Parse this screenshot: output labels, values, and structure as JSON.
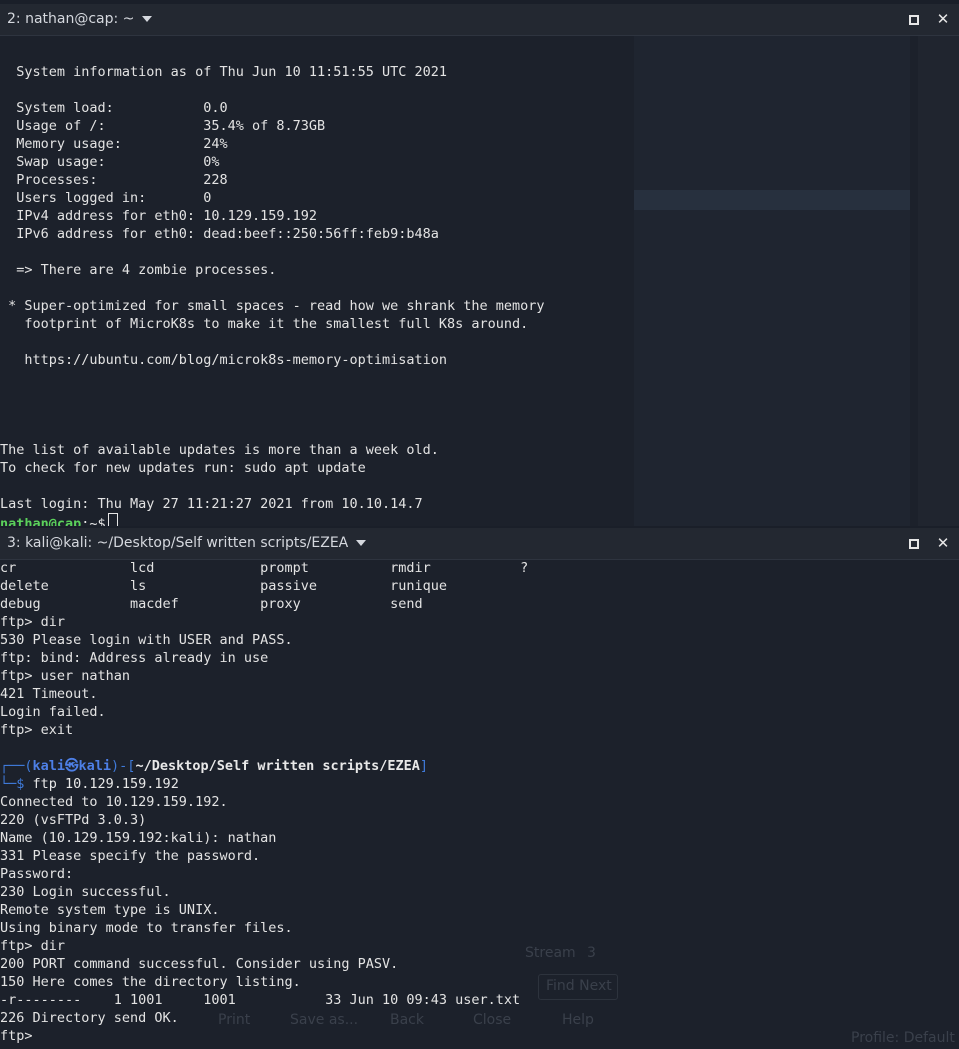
{
  "top_pane": {
    "title": "2: nathan@cap: ~",
    "lines": [
      "",
      "  System information as of Thu Jun 10 11:51:55 UTC 2021",
      "",
      "  System load:           0.0",
      "  Usage of /:            35.4% of 8.73GB",
      "  Memory usage:          24%",
      "  Swap usage:            0%",
      "  Processes:             228",
      "  Users logged in:       0",
      "  IPv4 address for eth0: 10.129.159.192",
      "  IPv6 address for eth0: dead:beef::250:56ff:feb9:b48a",
      "",
      "  => There are 4 zombie processes.",
      "",
      " * Super-optimized for small spaces - read how we shrank the memory",
      "   footprint of MicroK8s to make it the smallest full K8s around.",
      "",
      "   https://ubuntu.com/blog/microk8s-memory-optimisation",
      "",
      "",
      "",
      "",
      "The list of available updates is more than a week old.",
      "To check for new updates run: sudo apt update",
      "",
      "Last login: Thu May 27 11:21:27 2021 from 10.10.14.7"
    ],
    "prompt_user_host": "nathan@cap",
    "prompt_suffix": ":~$"
  },
  "bottom_pane": {
    "title": "3: kali@kali: ~/Desktop/Self written scripts/EZEA",
    "lines_before": [
      "cr              lcd             prompt          rmdir           ?",
      "delete          ls              passive         runique",
      "debug           macdef          proxy           send",
      "ftp> dir",
      "530 Please login with USER and PASS.",
      "ftp: bind: Address already in use",
      "ftp> user nathan",
      "421 Timeout.",
      "Login failed.",
      "ftp> exit",
      ""
    ],
    "prompt_head": "┌──(",
    "prompt_user": "kali㉿kali",
    "prompt_mid": ")-[",
    "prompt_path": "~/Desktop/Self written scripts/EZEA",
    "prompt_tail": "]",
    "prompt2_head": "└─$",
    "prompt2_cmd": " ftp 10.129.159.192",
    "lines_after": [
      "Connected to 10.129.159.192.",
      "220 (vsFTPd 3.0.3)",
      "Name (10.129.159.192:kali): nathan",
      "331 Please specify the password.",
      "Password:",
      "230 Login successful.",
      "Remote system type is UNIX.",
      "Using binary mode to transfer files.",
      "ftp> dir",
      "200 PORT command successful. Consider using PASV.",
      "150 Here comes the directory listing.",
      "-r--------    1 1001     1001           33 Jun 10 09:43 user.txt",
      "226 Directory send OK.",
      "ftp> "
    ]
  },
  "ghost_ui": {
    "stream_label": "Stream",
    "stream_value": "3",
    "find_next": "Find Next",
    "print": "Print",
    "save_as": "Save as...",
    "back": "Back",
    "close": "Close",
    "help": "Help",
    "profile": "Profile: Default"
  },
  "icons": {
    "maximize": "maximize-icon",
    "close": "close-icon",
    "dropdown": "chevron-down-icon"
  }
}
